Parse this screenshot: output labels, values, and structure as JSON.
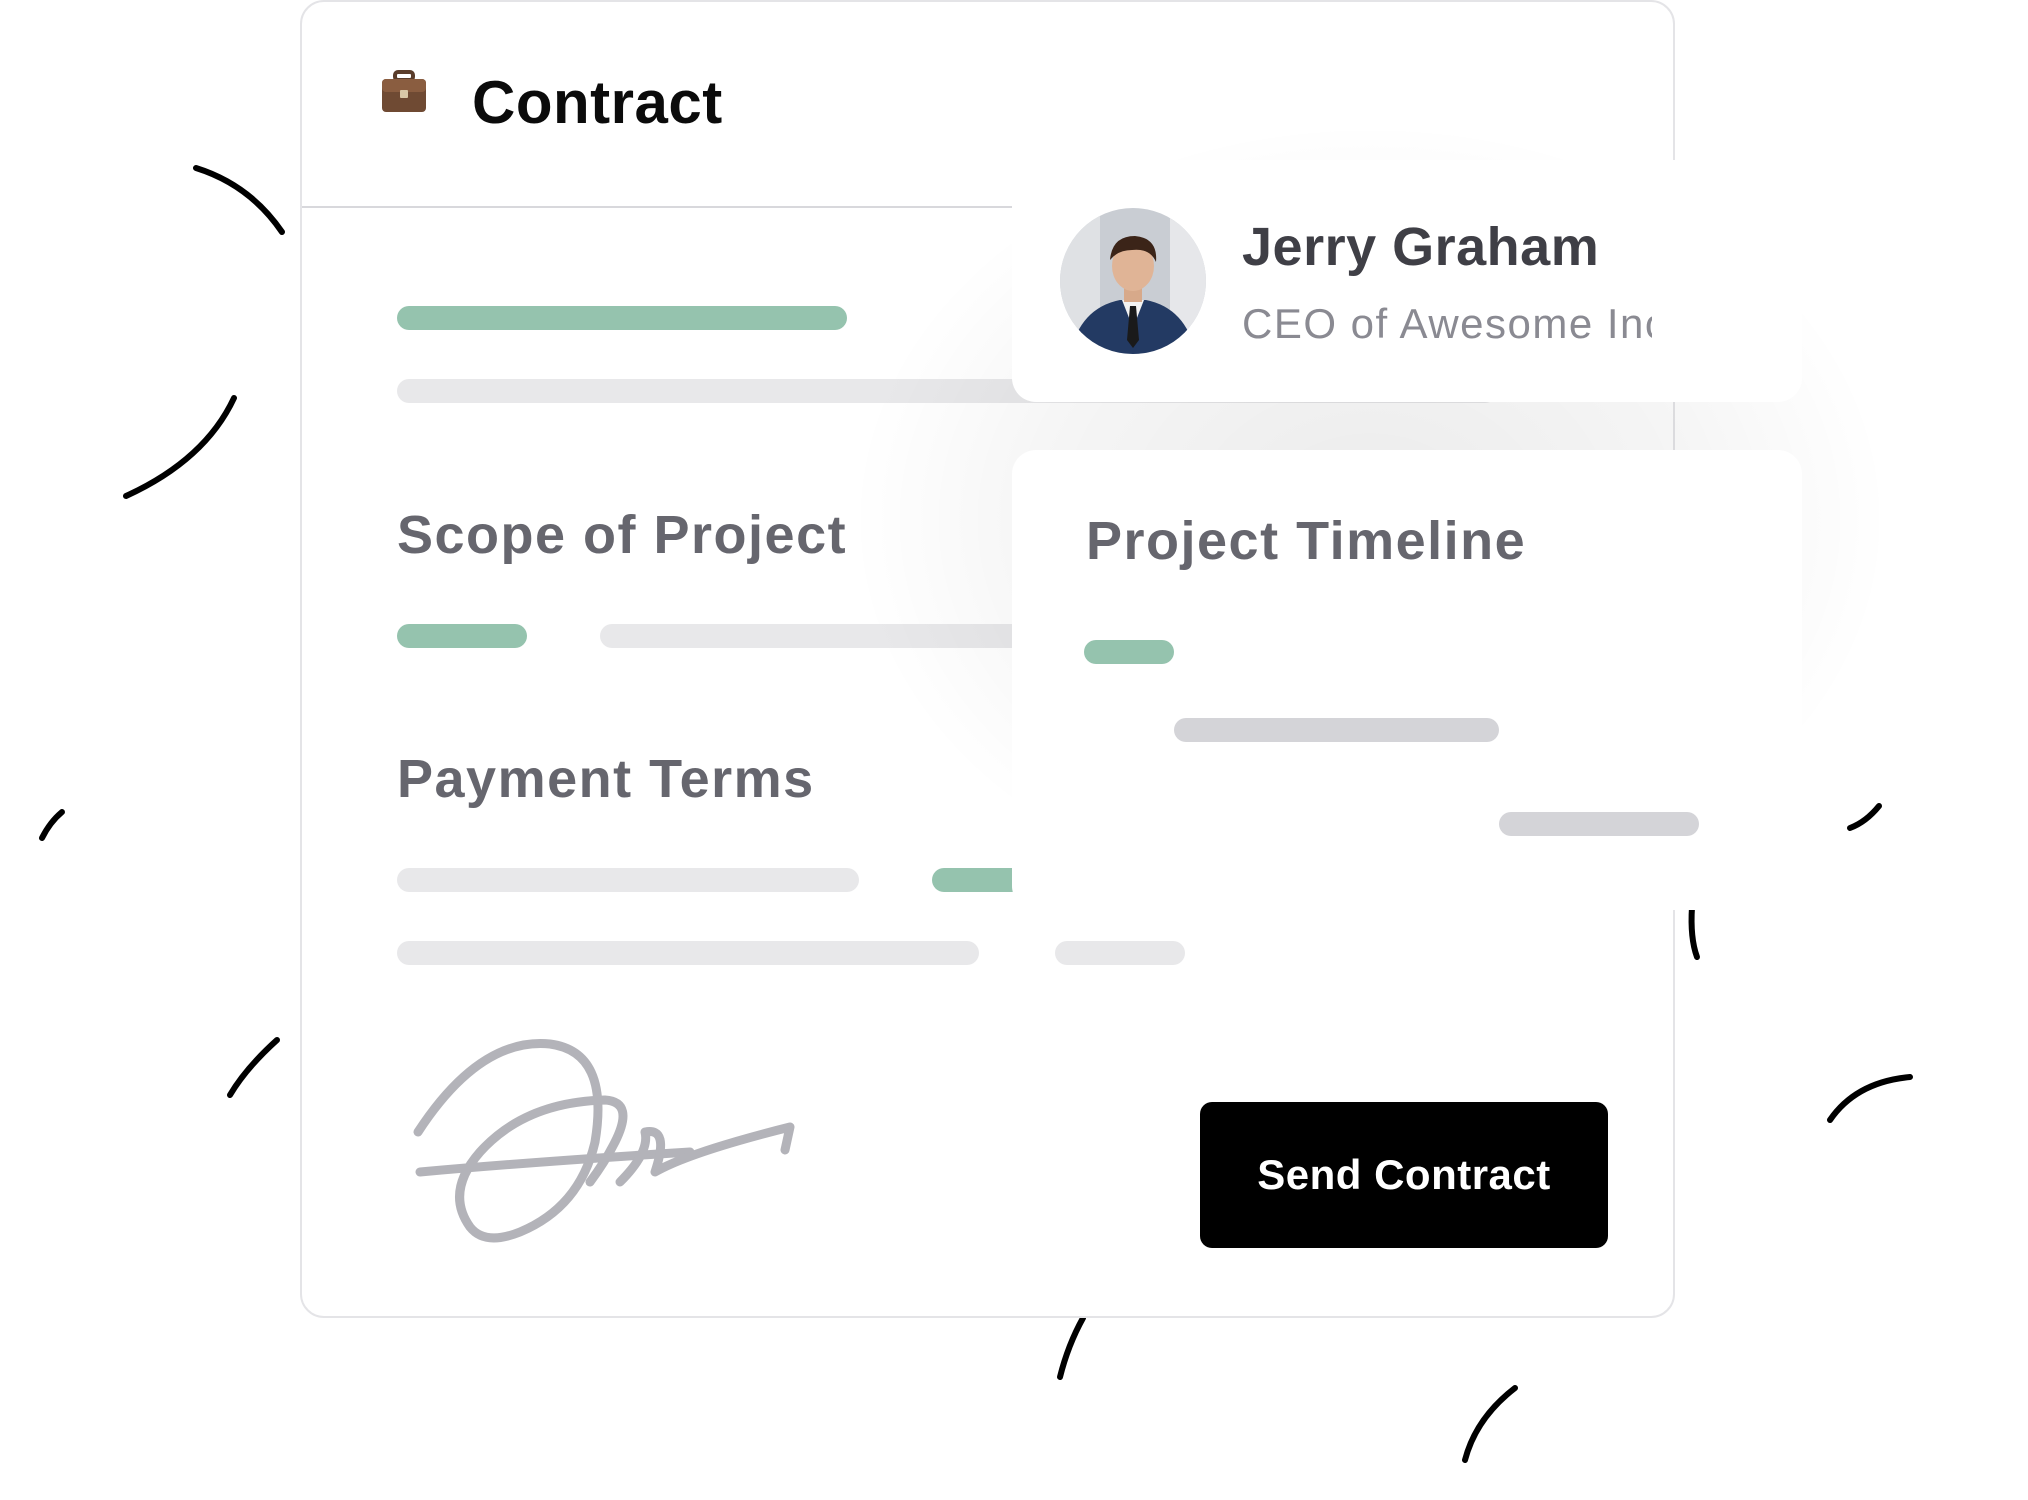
{
  "contract": {
    "title": "Contract",
    "icon": "briefcase-icon",
    "sections": {
      "scope": "Scope of Project",
      "payment": "Payment Terms"
    },
    "send_button_label": "Send Contract"
  },
  "profile": {
    "name": "Jerry Graham",
    "role": "CEO of Awesome Inc"
  },
  "timeline": {
    "title": "Project Timeline"
  },
  "colors": {
    "accent_green": "#95c3ae",
    "placeholder_grey": "#e8e8ea",
    "button_bg": "#000000",
    "heading_grey": "#66666e"
  }
}
